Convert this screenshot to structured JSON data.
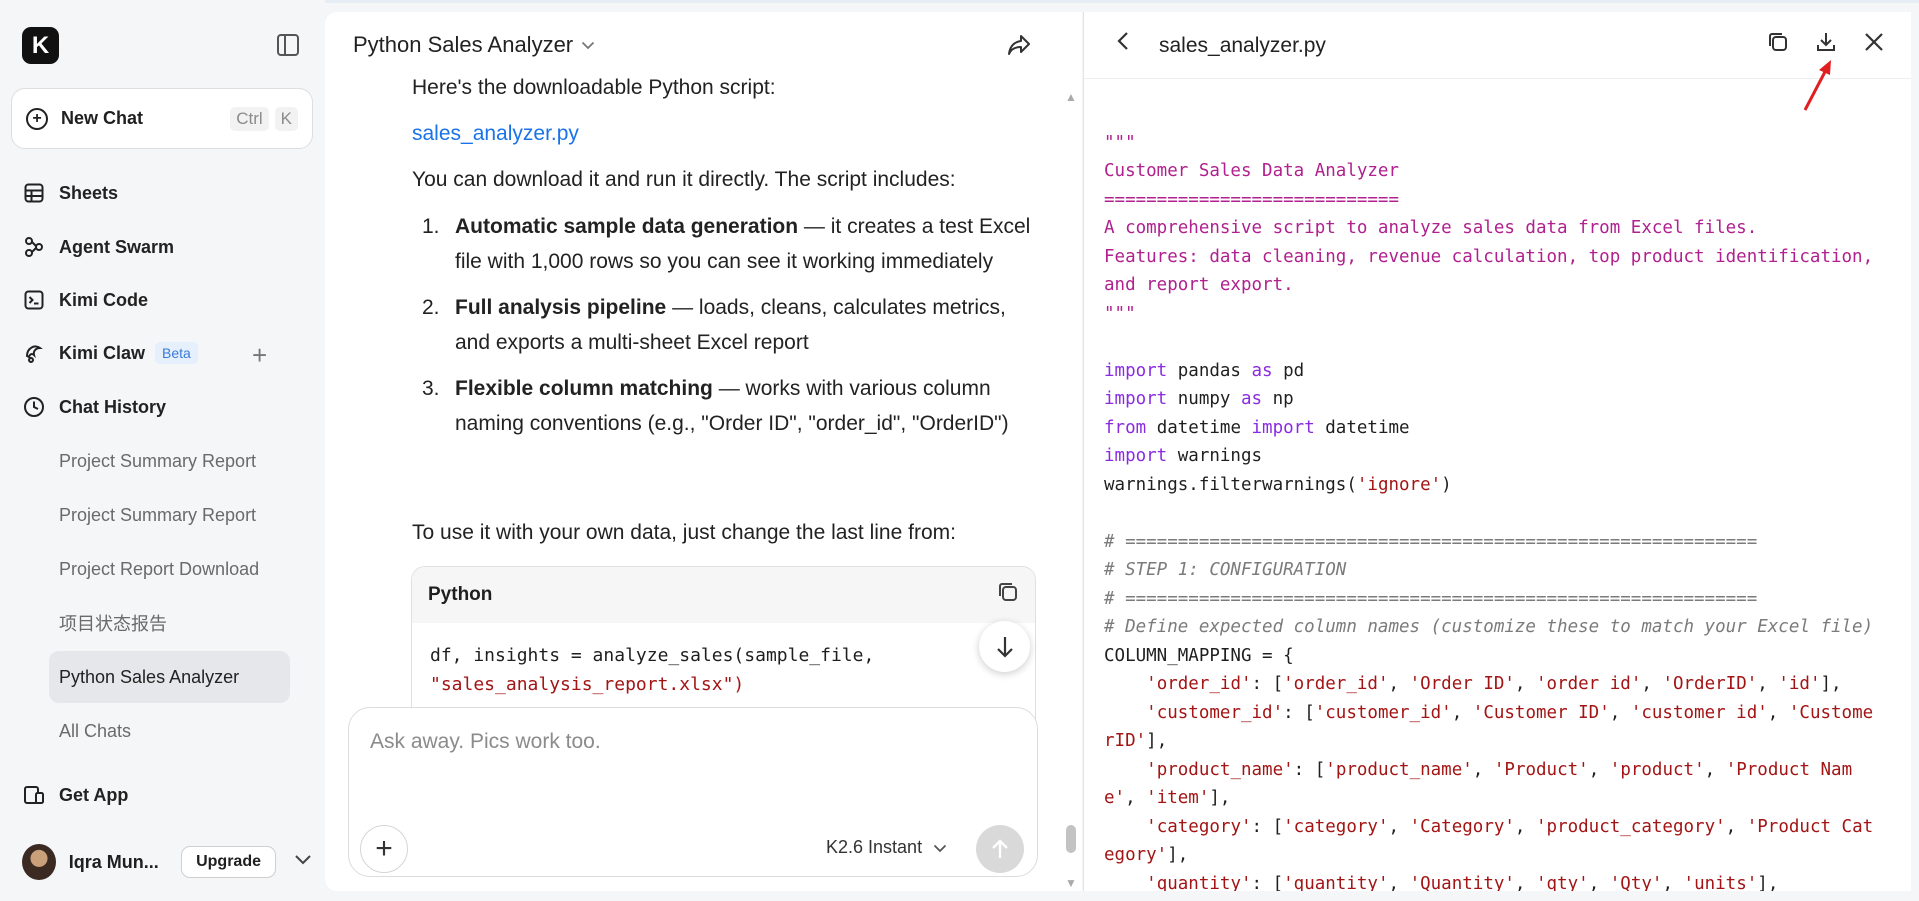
{
  "sidebar": {
    "logo": "K",
    "new_chat": {
      "label": "New Chat",
      "kbd1": "Ctrl",
      "kbd2": "K"
    },
    "nav": [
      {
        "label": "Sheets",
        "icon": "table-icon"
      },
      {
        "label": "Agent Swarm",
        "icon": "swarm-icon"
      },
      {
        "label": "Kimi Code",
        "icon": "terminal-icon"
      },
      {
        "label": "Kimi Claw",
        "icon": "claw-icon",
        "badge": "Beta"
      },
      {
        "label": "Chat History",
        "icon": "clock-icon"
      }
    ],
    "history": [
      "Project Summary Report",
      "Project Summary Report",
      "Project Report Download",
      "项目状态报告",
      "Python Sales Analyzer",
      "All Chats"
    ],
    "get_app": "Get App",
    "user": {
      "name": "Iqra Mun...",
      "upgrade": "Upgrade"
    }
  },
  "chat": {
    "title": "Python Sales Analyzer",
    "intro": "Here's the downloadable Python script:",
    "file_link": "sales_analyzer.py",
    "includes": "You can download it and run it directly. The script includes:",
    "list": [
      {
        "n": "1.",
        "bold": "Automatic sample data generation",
        "rest": " — it creates a test Excel file with 1,000 rows so you can see it working immediately"
      },
      {
        "n": "2.",
        "bold": "Full analysis pipeline",
        "rest": " — loads, cleans, calculates metrics, and exports a multi-sheet Excel report"
      },
      {
        "n": "3.",
        "bold": "Flexible column matching",
        "rest": " — works with various column naming conventions (e.g., \"Order ID\", \"order_id\", \"OrderID\")"
      }
    ],
    "usage": "To use it with your own data, just change the last line from:",
    "code_lang": "Python",
    "code_line1": "df, insights = analyze_sales(sample_file,",
    "code_line2": "\"sales_analysis_report.xlsx\")",
    "composer_placeholder": "Ask away. Pics work too.",
    "model": "K2.6 Instant"
  },
  "code_panel": {
    "filename": "sales_analyzer.py",
    "lines": {
      "l1": "\"\"\"",
      "l2": "Customer Sales Data Analyzer",
      "l3": "============================",
      "l4": "A comprehensive script to analyze sales data from Excel files.",
      "l5": "Features: data cleaning, revenue calculation, top product identification,",
      "l6": "and report export.",
      "l7": "\"\"\"",
      "c1": "# ============================================================",
      "c2": "# STEP 1: CONFIGURATION",
      "c3": "# ============================================================",
      "c4": "# Define expected column names (customize these to match your Excel file)"
    }
  }
}
